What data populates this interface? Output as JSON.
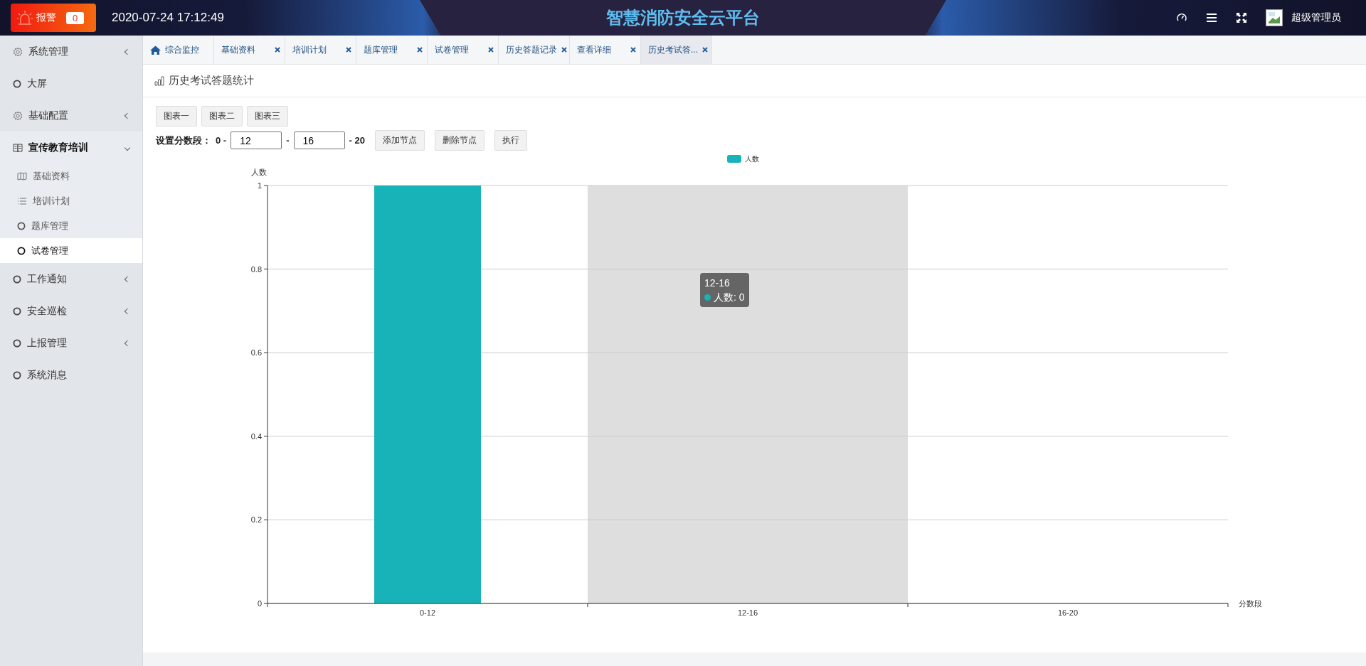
{
  "header": {
    "alarm": {
      "label": "报警",
      "count": "0"
    },
    "datetime": "2020-07-24 17:12:49",
    "title": "智慧消防安全云平台",
    "user": "超级管理员"
  },
  "sidebar": {
    "items": [
      {
        "kind": "gear",
        "label": "系统管理",
        "expanded": false,
        "selected": false
      },
      {
        "kind": "circle",
        "label": "大屏",
        "selected": false
      },
      {
        "kind": "gear",
        "label": "基础配置",
        "expanded": false,
        "selected": false
      },
      {
        "kind": "book",
        "label": "宣传教育培训",
        "expanded": true,
        "selected": false,
        "children": [
          {
            "kind": "map",
            "label": "基础资料",
            "selected": false
          },
          {
            "kind": "list",
            "label": "培训计划",
            "selected": false
          },
          {
            "kind": "circle",
            "label": "题库管理",
            "selected": false
          },
          {
            "kind": "circle",
            "label": "试卷管理",
            "selected": true
          }
        ]
      },
      {
        "kind": "circle",
        "label": "工作通知",
        "expanded": false,
        "selected": false
      },
      {
        "kind": "circle",
        "label": "安全巡检",
        "expanded": false,
        "selected": false
      },
      {
        "kind": "circle",
        "label": "上报管理",
        "expanded": false,
        "selected": false
      },
      {
        "kind": "circle",
        "label": "系统消息",
        "selected": false
      }
    ]
  },
  "tabs": [
    {
      "kind": "home",
      "label": "综合监控",
      "selected": false
    },
    {
      "kind": "page",
      "label": "基础资料",
      "selected": false
    },
    {
      "kind": "page",
      "label": "培训计划",
      "selected": false
    },
    {
      "kind": "page",
      "label": "题库管理",
      "selected": false
    },
    {
      "kind": "page",
      "label": "试卷管理",
      "selected": false
    },
    {
      "kind": "page",
      "label": "历史答题记录",
      "selected": false
    },
    {
      "kind": "page",
      "label": "查看详细",
      "selected": false
    },
    {
      "kind": "page",
      "label": "历史考试答...",
      "selected": true
    }
  ],
  "panel": {
    "title": "历史考试答题统计",
    "chart_buttons": [
      "图表一",
      "图表二",
      "图表三"
    ],
    "segments": {
      "label": "设置分数段：",
      "start": "0 -",
      "inputs": [
        "12",
        "16"
      ],
      "separator": "-",
      "end": "- 20"
    },
    "actions": [
      "添加节点",
      "删除节点",
      "执行"
    ]
  },
  "chart": {
    "tooltip": {
      "title": "12-16",
      "text": "人数: 0"
    },
    "chart_data": {
      "type": "bar",
      "grid": true,
      "xlabel": "分数段",
      "ylabel": "人数",
      "categories": [
        "0-12",
        "12-16",
        "16-20"
      ],
      "series": [
        {
          "name": "人数",
          "color": "#17b3b8",
          "values": [
            1,
            0,
            0
          ]
        }
      ],
      "ylim": [
        0,
        1
      ],
      "yticks": [
        0,
        0.2,
        0.4,
        0.6,
        0.8,
        1
      ],
      "bands": [
        {
          "axis": "x",
          "from": "12-16",
          "to": "12-16",
          "color": "#dedede"
        }
      ]
    }
  }
}
